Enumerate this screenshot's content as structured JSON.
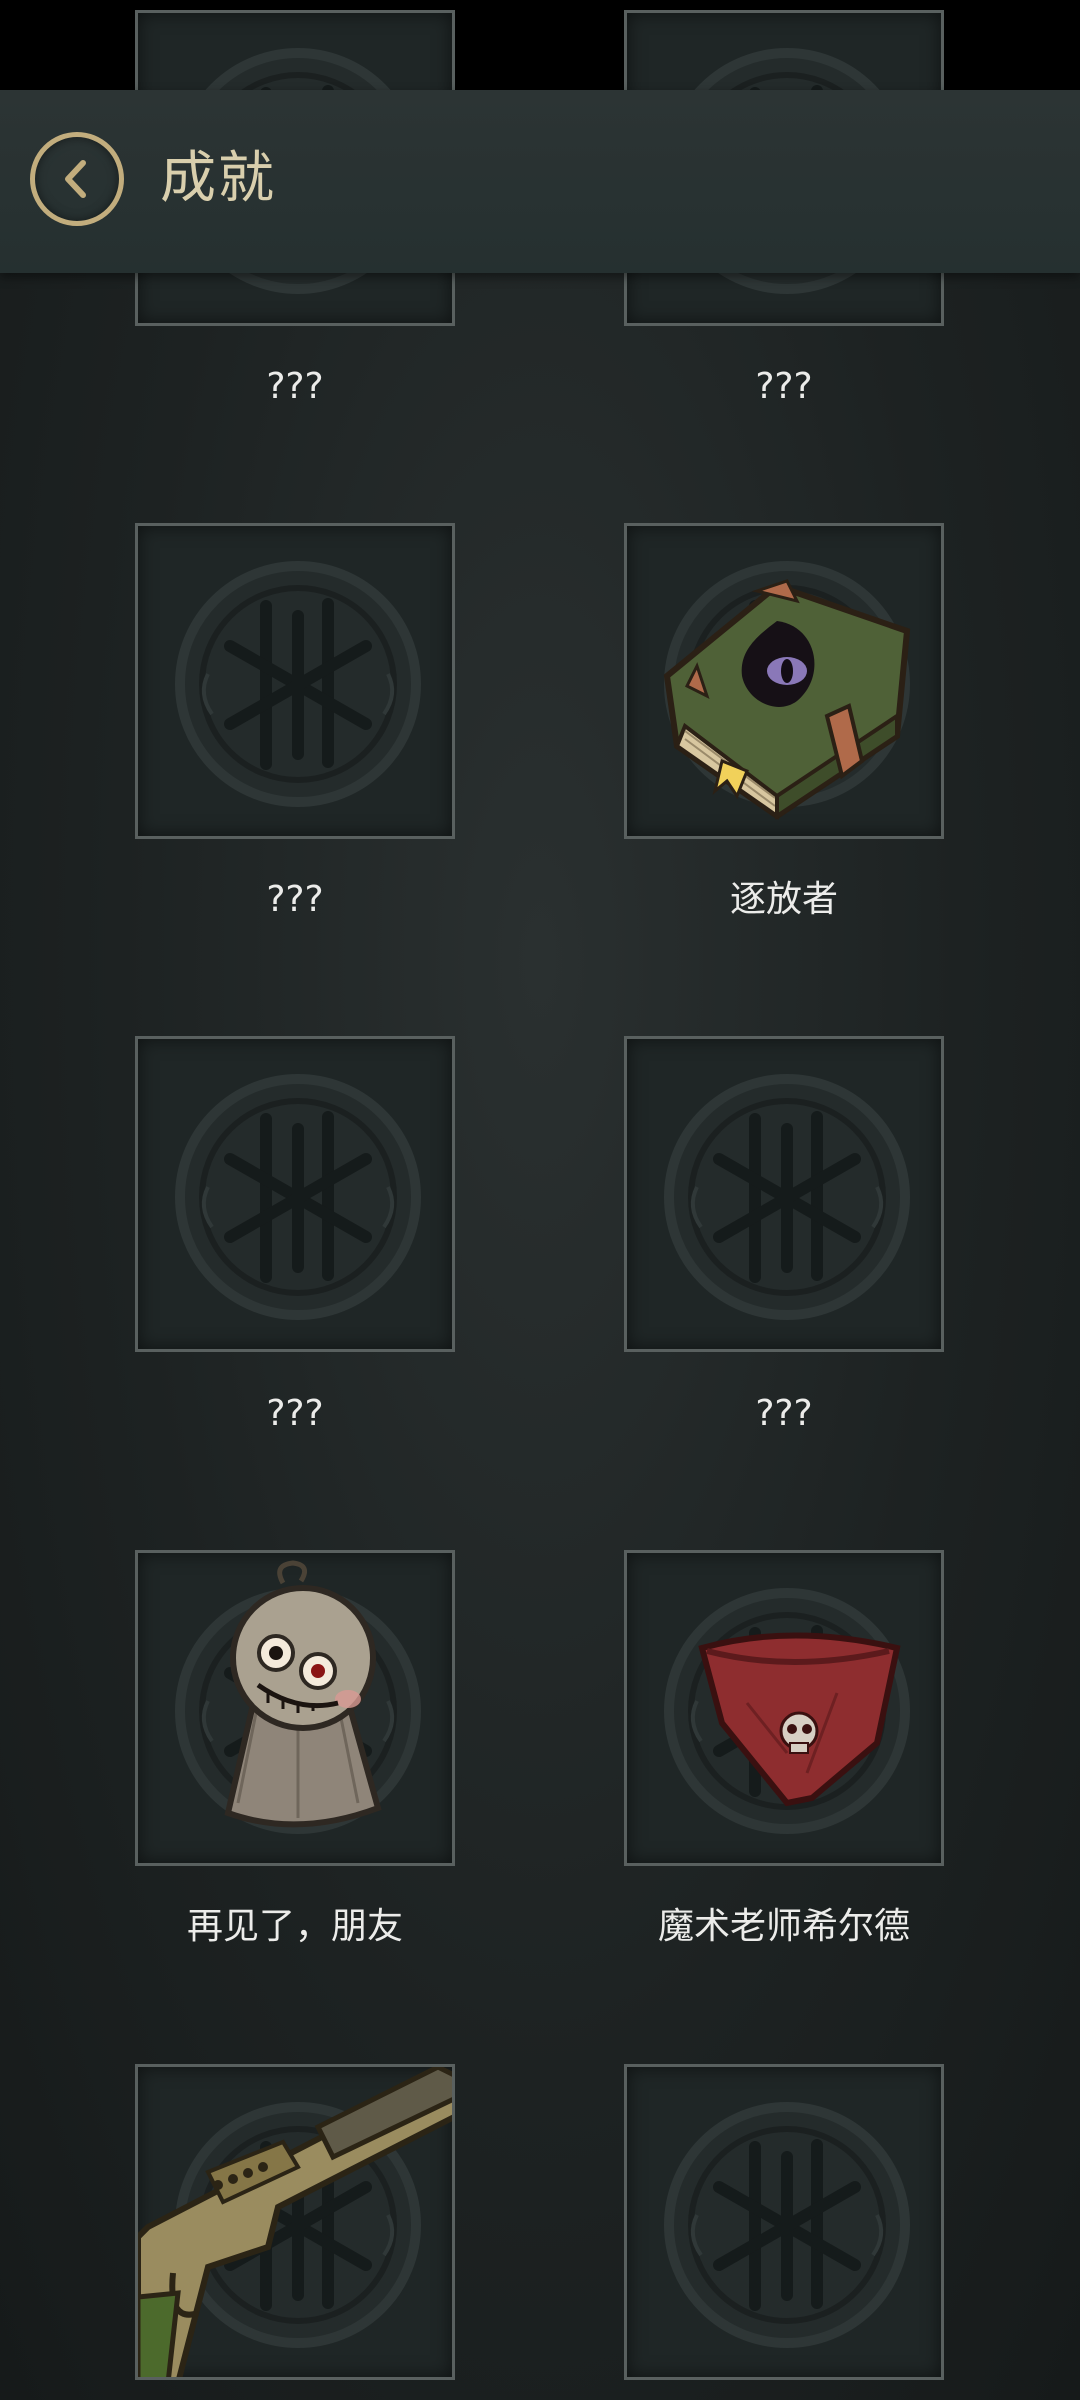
{
  "header": {
    "title": "成就"
  },
  "achievements": [
    {
      "label": "???",
      "locked": true,
      "icon": "locked-sigil-icon"
    },
    {
      "label": "???",
      "locked": true,
      "icon": "locked-sigil-icon"
    },
    {
      "label": "???",
      "locked": true,
      "icon": "locked-sigil-icon"
    },
    {
      "label": "逐放者",
      "locked": false,
      "icon": "eye-book-icon"
    },
    {
      "label": "???",
      "locked": true,
      "icon": "locked-sigil-icon"
    },
    {
      "label": "???",
      "locked": true,
      "icon": "locked-sigil-icon"
    },
    {
      "label": "再见了，朋友",
      "locked": false,
      "icon": "teru-teru-bozu-icon"
    },
    {
      "label": "魔术老师希尔德",
      "locked": false,
      "icon": "skull-bandana-icon"
    },
    {
      "label": "",
      "locked": false,
      "icon": "shotgun-icon"
    },
    {
      "label": "",
      "locked": true,
      "icon": "locked-sigil-icon"
    }
  ],
  "colors": {
    "accent": "#c2ad7d",
    "title": "#d9cfad",
    "card_border": "#59605f",
    "background": "#1d2222"
  }
}
